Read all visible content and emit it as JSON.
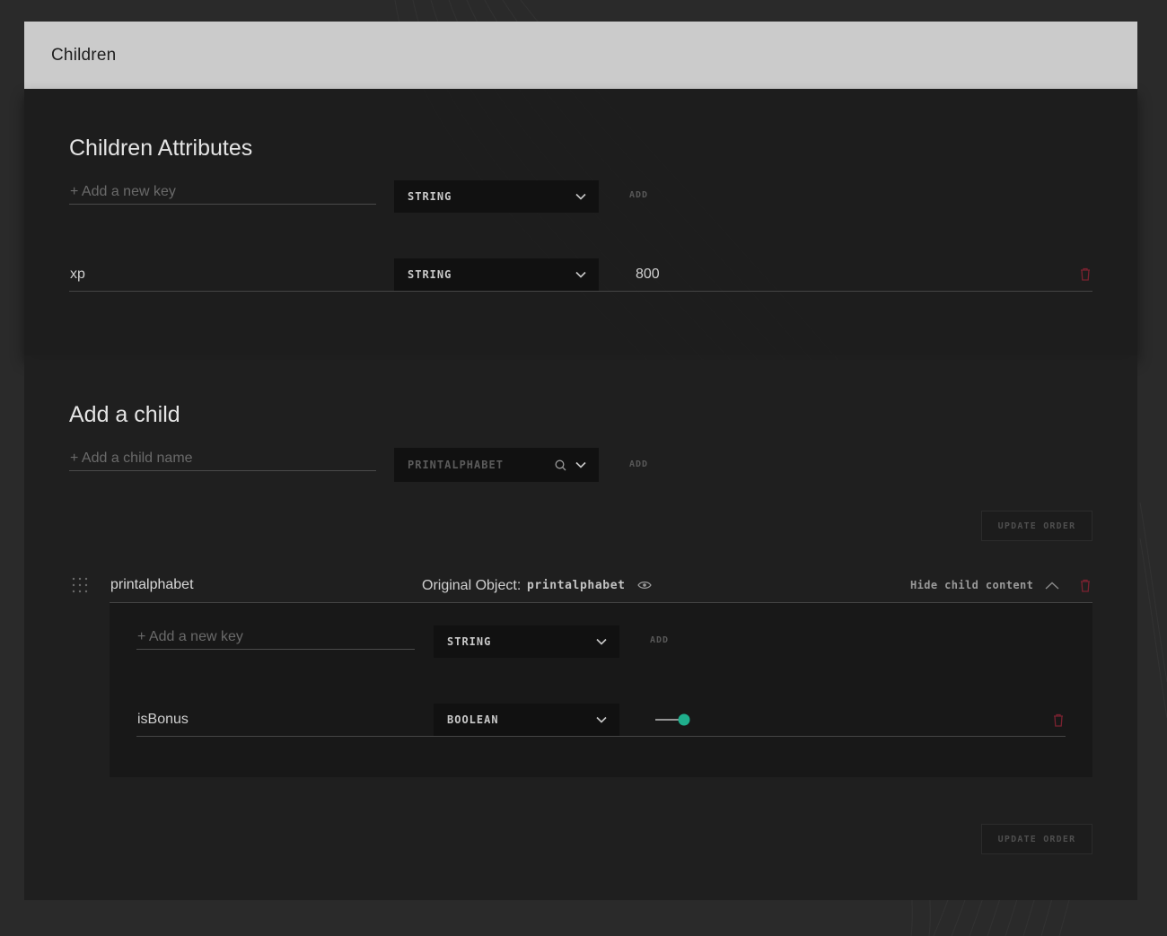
{
  "header": {
    "title": "Children"
  },
  "children_attributes": {
    "title": "Children Attributes",
    "new_key_placeholder": "+ Add a new key",
    "type_select": "STRING",
    "add_label": "ADD",
    "rows": [
      {
        "key": "xp",
        "type": "STRING",
        "value": "800"
      }
    ]
  },
  "add_child": {
    "title": "Add a child",
    "name_placeholder": "+ Add a child name",
    "object_select_placeholder": "PRINTALPHABET",
    "add_label": "ADD",
    "update_order_label": "UPDATE ORDER"
  },
  "child": {
    "name": "printalphabet",
    "original_object_label": "Original Object:",
    "original_object_value": "printalphabet",
    "hide_label": "Hide child content",
    "new_key_placeholder": "+ Add a new key",
    "type_select": "STRING",
    "add_label": "ADD",
    "rows": [
      {
        "key": "isBonus",
        "type": "BOOLEAN",
        "value": true
      }
    ]
  },
  "footer": {
    "update_order_label": "UPDATE ORDER"
  },
  "colors": {
    "accent": "#1fae8c",
    "danger": "#7a2230",
    "header_bg": "#cbcbcb"
  },
  "icons": [
    "chevron-down-icon",
    "search-icon",
    "trash-icon",
    "drag-handle-icon",
    "eye-icon",
    "chevron-up-icon"
  ]
}
